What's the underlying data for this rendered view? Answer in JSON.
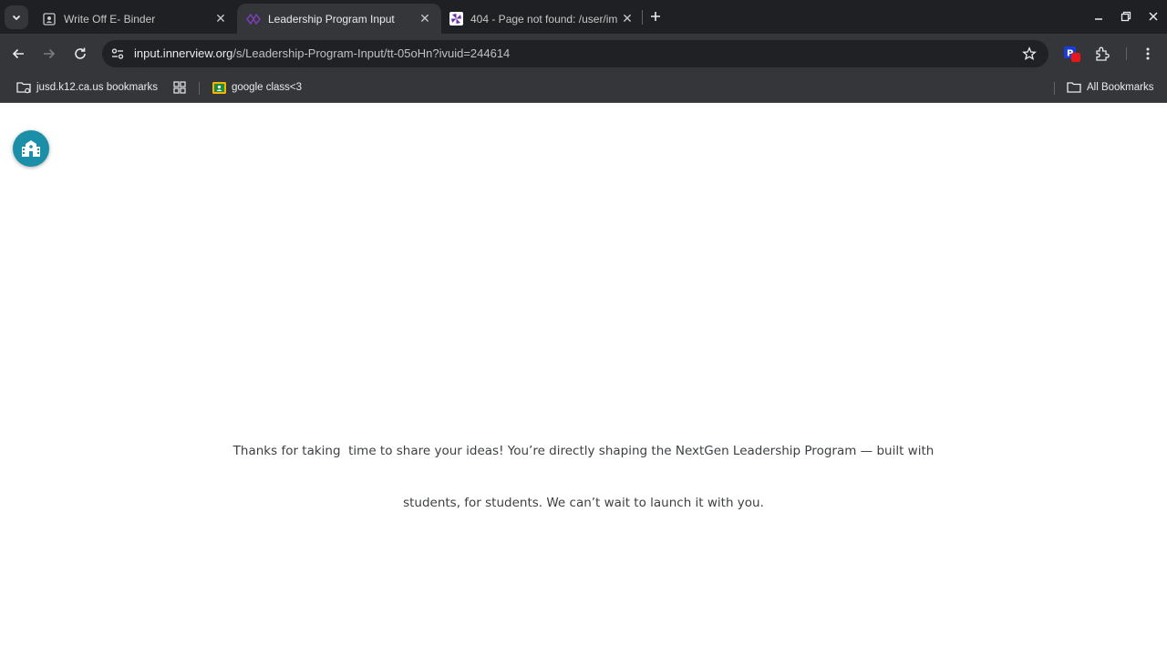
{
  "browser": {
    "tabs": [
      {
        "title": "Write Off E- Binder",
        "favicon": "portrait-icon",
        "active": false
      },
      {
        "title": "Leadership Program Input",
        "favicon": "innerview-icon",
        "active": true
      },
      {
        "title": "404 - Page not found: /user/im",
        "favicon": "pinwheel-icon",
        "active": false
      }
    ],
    "address": {
      "host": "input.innerview.org",
      "path": "/s/Leadership-Program-Input/tt-05oHn?ivuid=244614"
    },
    "bookmarks": [
      {
        "label": "jusd.k12.ca.us bookmarks",
        "icon": "managed-folder-icon"
      },
      {
        "label": "",
        "icon": "apps-grid-icon"
      },
      {
        "label": "google class<3",
        "icon": "google-classroom-icon"
      }
    ],
    "all_bookmarks_label": "All Bookmarks"
  },
  "page": {
    "message_line1": "Thanks for taking  time to share your ideas! You’re directly shaping the NextGen Leadership Program — built with",
    "message_line2": "students, for students. We can’t wait to launch it with you.",
    "fab_icon": "school-building-icon",
    "accent_color": "#1b8fa8"
  }
}
